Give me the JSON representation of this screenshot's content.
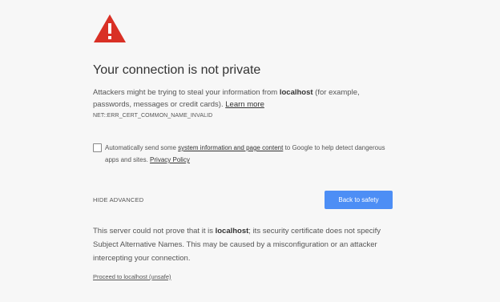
{
  "icon": {
    "name": "warning-triangle-icon",
    "color": "#d93025",
    "mark": "!"
  },
  "heading": {
    "title": "Your connection is not private"
  },
  "description": {
    "part1": "Attackers might be trying to steal your information from ",
    "host": "localhost",
    "part2": " (for example, passwords, messages or credit cards). ",
    "learn_more": "Learn more"
  },
  "error_code": "NET::ERR_CERT_COMMON_NAME_INVALID",
  "opt_in": {
    "checked": false,
    "part1": "Automatically send some ",
    "link": "system information and page content",
    "part2": " to Google to help detect dangerous apps and sites. ",
    "privacy_link": "Privacy Policy"
  },
  "actions": {
    "hide_advanced": "HIDE ADVANCED",
    "back_to_safety": "Back to safety",
    "button_color": "#4d8ef5"
  },
  "details": {
    "part1": "This server could not prove that it is ",
    "host": "localhost",
    "part2": "; its security certificate does not specify Subject Alternative Names. This may be caused by a misconfiguration or an attacker intercepting your connection."
  },
  "proceed_link": "Proceed to localhost (unsafe)"
}
